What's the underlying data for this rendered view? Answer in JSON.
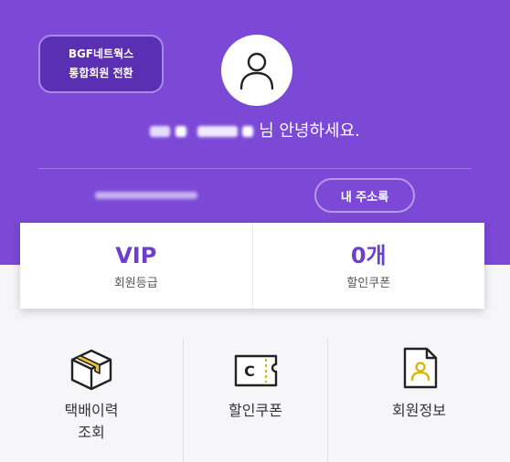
{
  "header": {
    "convert_button_line1": "BGF네트웍스",
    "convert_button_line2": "통합회원 전환",
    "greeting_suffix": "님 안녕하세요.",
    "address_book_label": "내 주소록"
  },
  "stats": [
    {
      "value": "VIP",
      "label": "회원등급"
    },
    {
      "value": "0개",
      "label": "할인쿠폰"
    }
  ],
  "menu": [
    {
      "label": "택배이력\n조회",
      "icon": "package-icon"
    },
    {
      "label": "할인쿠폰",
      "icon": "coupon-icon"
    },
    {
      "label": "회원정보",
      "icon": "member-card-icon"
    }
  ],
  "colors": {
    "brand": "#7b49d6",
    "accent": "#6c3fcc",
    "button_dark": "#5b2fb1"
  }
}
